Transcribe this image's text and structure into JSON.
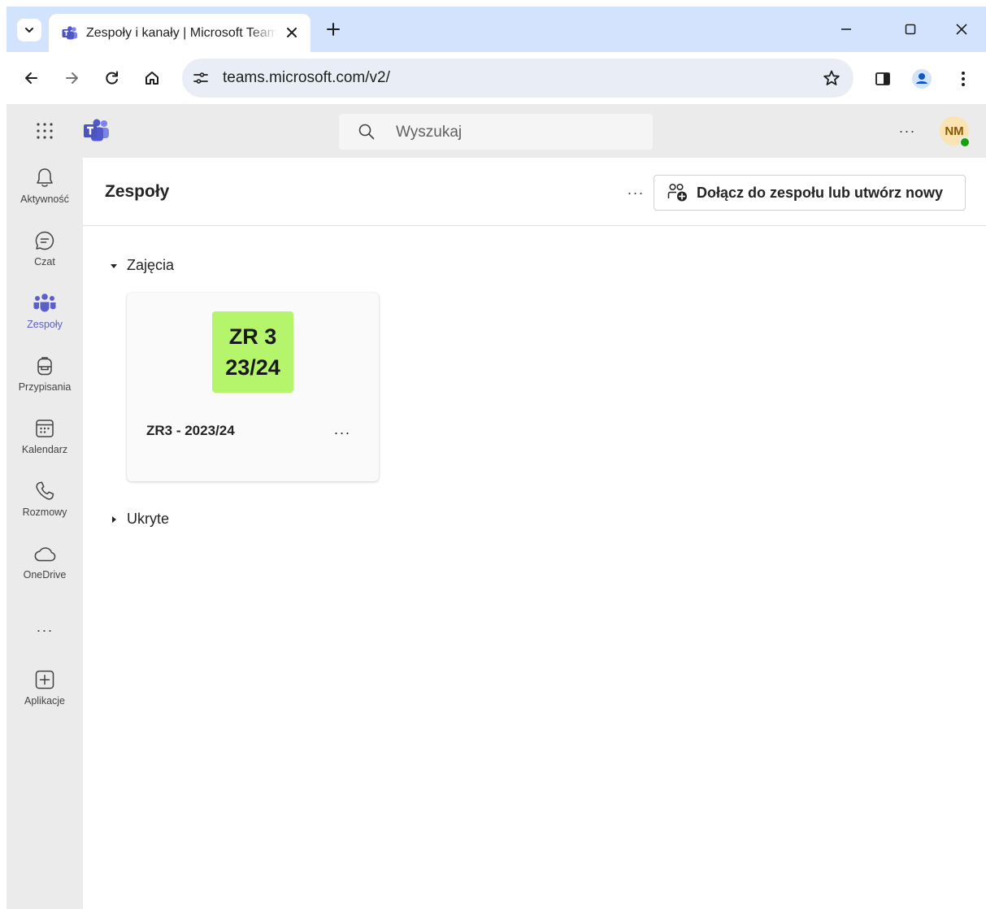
{
  "browser": {
    "tab_title": "Zespoły i kanały | Microsoft Teams",
    "url": "teams.microsoft.com/v2/"
  },
  "header": {
    "search_placeholder": "Wyszukaj",
    "more": "···",
    "avatar_initials": "NM",
    "presence_color": "#13a10e"
  },
  "appbar": {
    "items": [
      {
        "label": "Aktywność",
        "icon": "bell-icon"
      },
      {
        "label": "Czat",
        "icon": "chat-icon"
      },
      {
        "label": "Zespoły",
        "icon": "teams-icon",
        "active": true
      },
      {
        "label": "Przypisania",
        "icon": "backpack-icon"
      },
      {
        "label": "Kalendarz",
        "icon": "calendar-icon"
      },
      {
        "label": "Rozmowy",
        "icon": "phone-icon"
      },
      {
        "label": "OneDrive",
        "icon": "cloud-icon"
      }
    ],
    "more": "···",
    "apps": {
      "label": "Aplikacje",
      "icon": "add-app-icon"
    }
  },
  "main": {
    "title": "Zespoły",
    "more": "···",
    "join_button": "Dołącz do zespołu lub utwórz nowy",
    "groups": [
      {
        "label": "Zajęcia",
        "expanded": true
      },
      {
        "label": "Ukryte",
        "expanded": false
      }
    ],
    "team_card": {
      "tile_line1": "ZR 3",
      "tile_line2": "23/24",
      "tile_color": "#b5f56c",
      "name": "ZR3 - 2023/24",
      "more": "···"
    }
  },
  "colors": {
    "accent": "#5b5fc7",
    "tabbar": "#d3e3fd",
    "chrome_bg": "#ebebeb"
  }
}
